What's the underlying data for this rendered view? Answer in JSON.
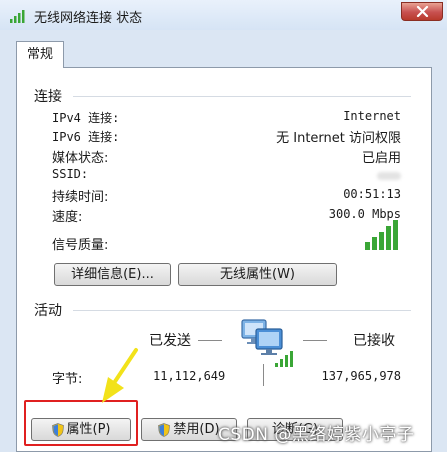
{
  "window": {
    "title": "无线网络连接 状态"
  },
  "tabs": [
    {
      "label": "常规"
    }
  ],
  "connection": {
    "heading": "连接",
    "rows": [
      {
        "label": "IPv4 连接:",
        "value": "Internet"
      },
      {
        "label": "IPv6 连接:",
        "value": "无 Internet 访问权限"
      },
      {
        "label": "媒体状态:",
        "value": "已启用"
      },
      {
        "label": "SSID:",
        "value": ""
      },
      {
        "label": "持续时间:",
        "value": "00:51:13"
      },
      {
        "label": "速度:",
        "value": "300.0 Mbps"
      }
    ],
    "signal_label": "信号质量:",
    "signal_bars": 5,
    "details_button": "详细信息(E)...",
    "wireless_props_button": "无线属性(W)"
  },
  "activity": {
    "heading": "活动",
    "sent_label": "已发送",
    "received_label": "已接收",
    "bytes_label": "字节:",
    "bytes_sent": "11,112,649",
    "bytes_received": "137,965,978"
  },
  "bottom_buttons": {
    "properties": "属性(P)",
    "disable": "禁用(D)",
    "diagnose": "诊断(G)"
  },
  "watermark": "CSDN @黑络婷紫小亭子",
  "colors": {
    "signal_green": "#3aa636",
    "highlight_red": "#e02020",
    "arrow_yellow": "#f2e21a"
  }
}
